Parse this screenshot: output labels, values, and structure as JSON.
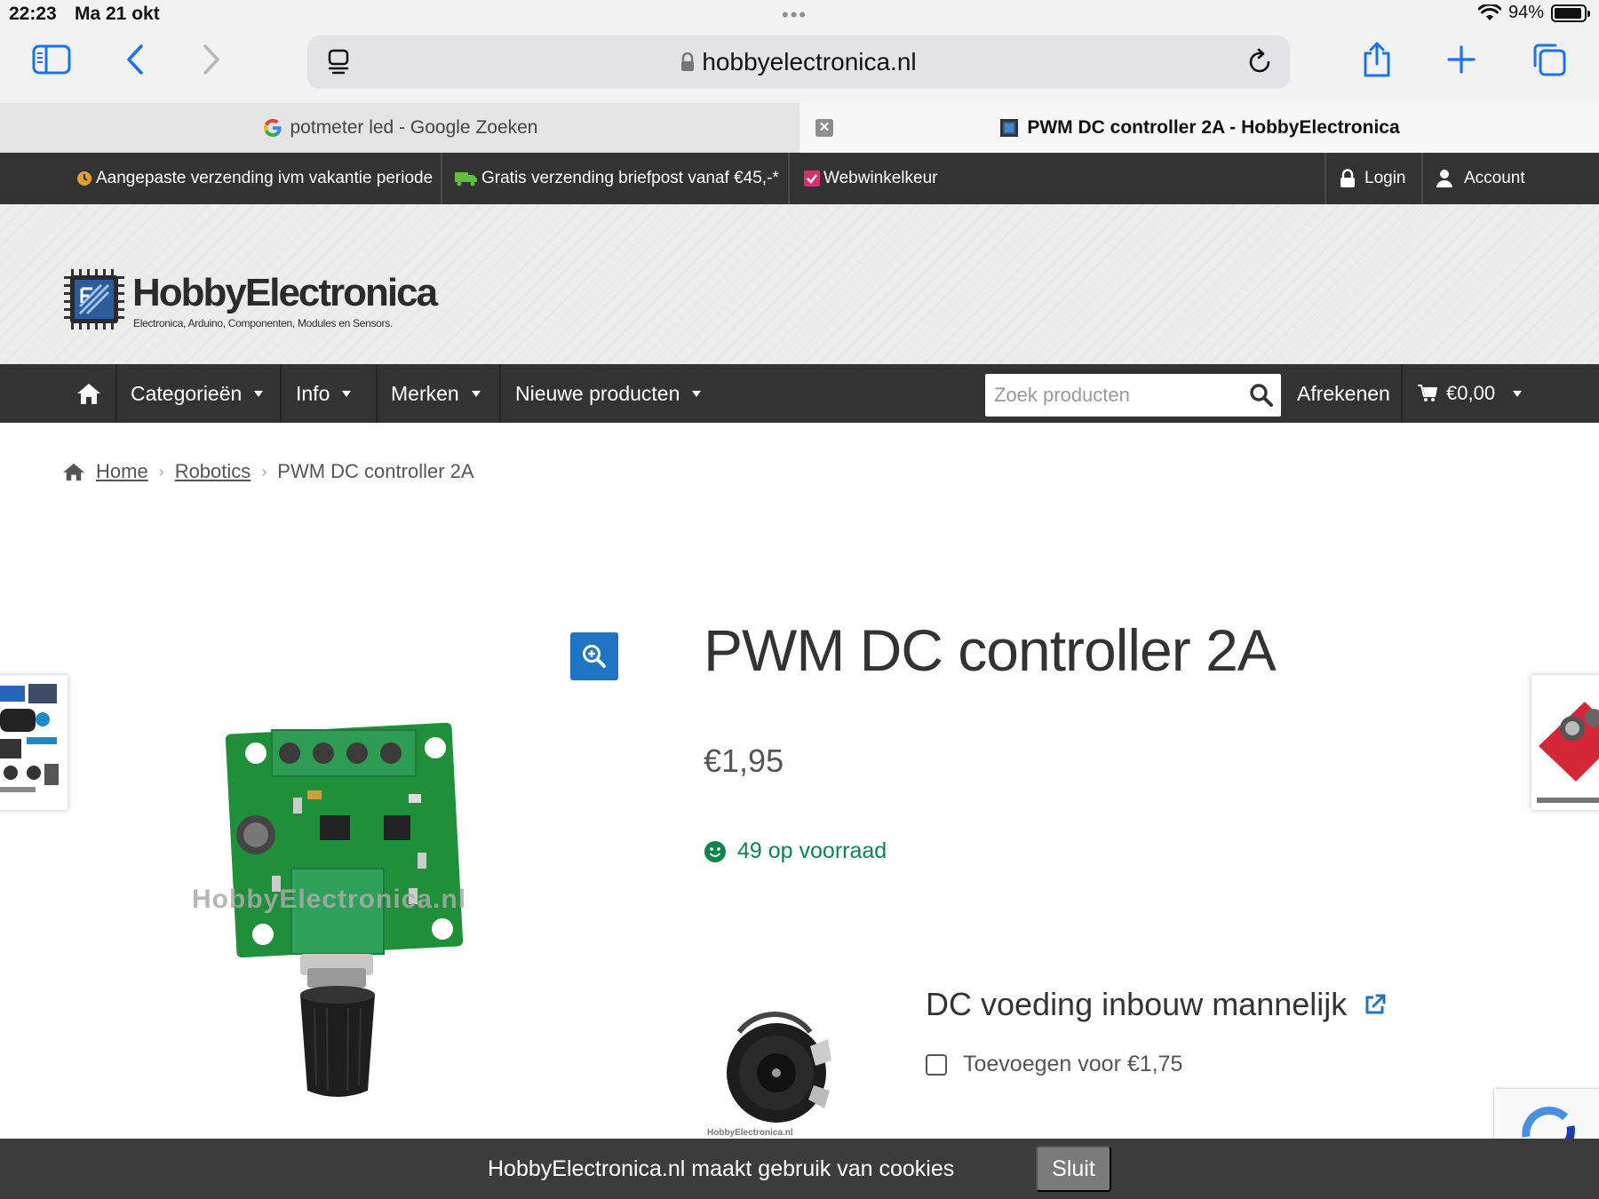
{
  "status_bar": {
    "time": "22:23",
    "date": "Ma 21 okt",
    "battery_percent": "94%",
    "battery_level": 0.94
  },
  "browser": {
    "url": "hobbyelectronica.nl",
    "toolbar_icons": [
      "sidebar-icon",
      "back-icon",
      "forward-icon",
      "reader-icon",
      "reload-icon",
      "share-icon",
      "new-tab-icon",
      "tabs-overview-icon"
    ],
    "tabs": [
      {
        "title": "potmeter led - Google Zoeken",
        "active": false
      },
      {
        "title": "PWM DC controller 2A - HobbyElectronica",
        "active": true
      }
    ]
  },
  "topbar": {
    "notices": [
      {
        "text": "Aangepaste verzending ivm vakantie periode",
        "icon": "clock-icon",
        "color": "#e0a030"
      },
      {
        "text": "Gratis verzending briefpost vanaf €45,-*",
        "icon": "truck-icon",
        "color": "#5fbf3f"
      },
      {
        "text": "Webwinkelkeur",
        "icon": "check-square-icon",
        "color": "#d6306f"
      }
    ],
    "login_label": "Login",
    "account_label": "Account"
  },
  "header": {
    "logo_name": "HobbyElectronica",
    "logo_tagline": "Electronica, Arduino, Componenten, Modules en Sensors."
  },
  "nav": {
    "items": [
      {
        "label": "Categorieën"
      },
      {
        "label": "Info"
      },
      {
        "label": "Merken"
      },
      {
        "label": "Nieuwe producten"
      }
    ],
    "search_placeholder": "Zoek producten",
    "checkout_label": "Afrekenen",
    "cart_total": "€0,00"
  },
  "breadcrumb": {
    "home": "Home",
    "category": "Robotics",
    "current": "PWM DC controller 2A"
  },
  "product": {
    "title": "PWM DC controller 2A",
    "price": "€1,95",
    "stock": "49 op voorraad",
    "image_watermark": "HobbyElectronica.nl"
  },
  "addon": {
    "title": "DC voeding inbouw mannelijk",
    "option_label": "Toevoegen voor €1,75",
    "thumb_watermark": "HobbyElectronica.nl"
  },
  "cookie": {
    "text": "HobbyElectronica.nl maakt gebruik van cookies",
    "button": "Sluit"
  },
  "colors": {
    "accent_blue": "#1f75c3",
    "stock_green": "#0f834d",
    "bar_dark": "#333333",
    "browser_blue": "#1a73e8"
  }
}
